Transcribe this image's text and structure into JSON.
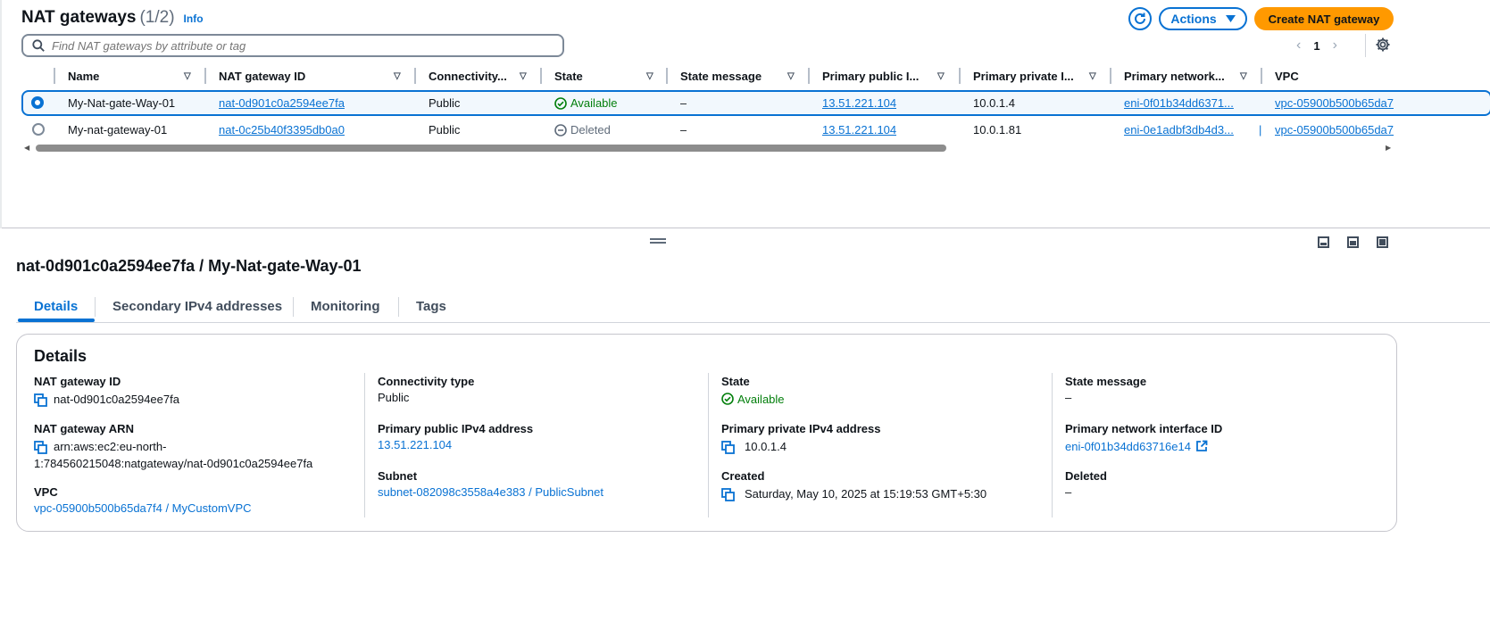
{
  "header": {
    "title": "NAT gateways",
    "count": "(1/2)",
    "info": "Info",
    "actions_label": "Actions",
    "create_label": "Create NAT gateway"
  },
  "search": {
    "placeholder": "Find NAT gateways by attribute or tag"
  },
  "pagination": {
    "current_page": "1"
  },
  "table": {
    "columns": [
      "Name",
      "NAT gateway ID",
      "Connectivity...",
      "State",
      "State message",
      "Primary public I...",
      "Primary private I...",
      "Primary network...",
      "VPC"
    ],
    "rows": [
      {
        "selected": true,
        "name": "My-Nat-gate-Way-01",
        "id": "nat-0d901c0a2594ee7fa",
        "connectivity": "Public",
        "state": "Available",
        "state_message": "–",
        "public_ip": "13.51.221.104",
        "private_ip": "10.0.1.4",
        "eni": "eni-0f01b34dd6371...",
        "vpc": "vpc-05900b500b65da7"
      },
      {
        "selected": false,
        "name": "My-nat-gateway-01",
        "id": "nat-0c25b40f3395db0a0",
        "connectivity": "Public",
        "state": "Deleted",
        "state_message": "–",
        "public_ip": "13.51.221.104",
        "private_ip": "10.0.1.81",
        "eni": "eni-0e1adbf3db4d3...",
        "vpc": "vpc-05900b500b65da7"
      }
    ]
  },
  "detail": {
    "title": "nat-0d901c0a2594ee7fa / My-Nat-gate-Way-01",
    "tabs": [
      "Details",
      "Secondary IPv4 addresses",
      "Monitoring",
      "Tags"
    ],
    "card_title": "Details",
    "fields": {
      "nat_gateway_id_label": "NAT gateway ID",
      "nat_gateway_id": "nat-0d901c0a2594ee7fa",
      "nat_gateway_arn_label": "NAT gateway ARN",
      "nat_gateway_arn_line1": "arn:aws:ec2:eu-north-",
      "nat_gateway_arn_line2": "1:784560215048:natgateway/nat-0d901c0a2594ee7fa",
      "vpc_label": "VPC",
      "vpc": "vpc-05900b500b65da7f4 / MyCustomVPC",
      "connectivity_label": "Connectivity type",
      "connectivity": "Public",
      "public_ip_label": "Primary public IPv4 address",
      "public_ip": "13.51.221.104",
      "subnet_label": "Subnet",
      "subnet": "subnet-082098c3558a4e383 / PublicSubnet",
      "state_label": "State",
      "state": "Available",
      "private_ip_label": "Primary private IPv4 address",
      "private_ip": "10.0.1.4",
      "created_label": "Created",
      "created": "Saturday, May 10, 2025 at 15:19:53 GMT+5:30",
      "state_message_label": "State message",
      "state_message": "–",
      "eni_label": "Primary network interface ID",
      "eni": "eni-0f01b34dd63716e14",
      "deleted_label": "Deleted",
      "deleted": "–"
    }
  },
  "colors": {
    "link": "#0972d3",
    "success": "#037f0c",
    "primary_button": "#ff9900"
  }
}
